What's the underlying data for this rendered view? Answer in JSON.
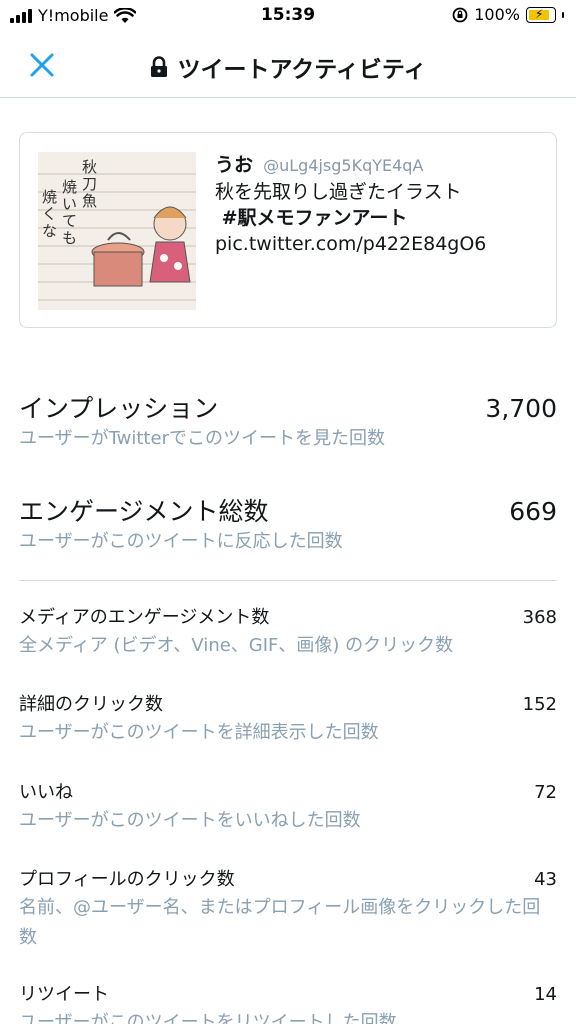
{
  "status_bar": {
    "carrier": "Y!mobile",
    "time": "15:39",
    "battery_percent": "100%",
    "icons": [
      "signal-icon",
      "wifi-icon",
      "rotation-lock-icon",
      "battery-charging-icon"
    ]
  },
  "header": {
    "title": "ツイートアクティビティ",
    "icons": [
      "close-icon",
      "lock-icon"
    ],
    "accent_color": "#1da1f2"
  },
  "tweet": {
    "name": "うお",
    "handle": "@uLg4jsg5KqYE4qA",
    "text_line1": "秋を先取りし過ぎたイラスト",
    "hashtag": "#駅メモファンアート",
    "link": "pic.twitter.com/p422E84gO6",
    "thumbnail_text": "秋刀魚 焼いても 焼くな"
  },
  "metrics": {
    "impressions": {
      "label": "インプレッション",
      "value": "3,700",
      "desc": "ユーザーがTwitterでこのツイートを見た回数"
    },
    "engagements": {
      "label": "エンゲージメント総数",
      "value": "669",
      "desc": "ユーザーがこのツイートに反応した回数"
    }
  },
  "details": [
    {
      "label": "メディアのエンゲージメント数",
      "value": "368",
      "desc": "全メディア (ビデオ、Vine、GIF、画像) のクリック数"
    },
    {
      "label": "詳細のクリック数",
      "value": "152",
      "desc": "ユーザーがこのツイートを詳細表示した回数"
    },
    {
      "label": "いいね",
      "value": "72",
      "desc": "ユーザーがこのツイートをいいねした回数"
    },
    {
      "label": "プロフィールのクリック数",
      "value": "43",
      "desc": "名前、@ユーザー名、またはプロフィール画像をクリックした回数"
    },
    {
      "label": "リツイート",
      "value": "14",
      "desc": "ユーザーがこのツイートをリツイートした回数"
    }
  ],
  "colors": {
    "secondary_text": "#8aa0b3",
    "divider": "#d7dde2"
  }
}
